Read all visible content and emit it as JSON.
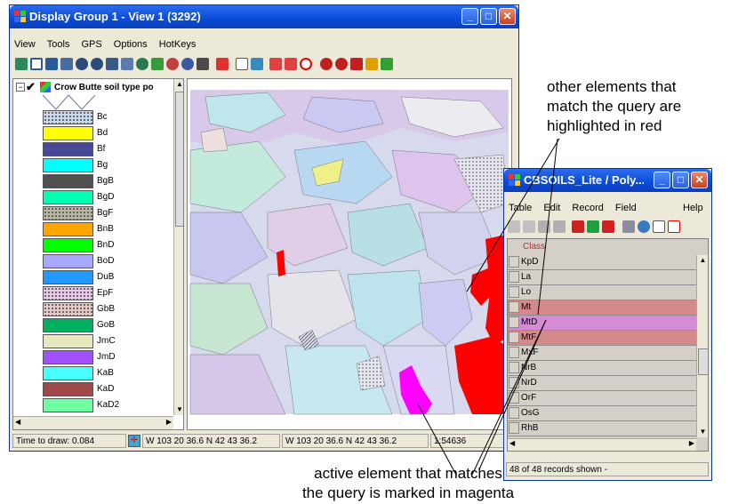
{
  "main_window": {
    "title": "Display Group 1 - View 1 (3292)",
    "menu": [
      "View",
      "Tools",
      "GPS",
      "Options",
      "HotKeys"
    ]
  },
  "layer_tree": {
    "layer_name": "Crow Butte soil type po",
    "items": [
      {
        "label": "Bc",
        "color": "#c8d8ec",
        "dots": true
      },
      {
        "label": "Bd",
        "color": "#ffff00",
        "dots": false
      },
      {
        "label": "Bf",
        "color": "#484898",
        "dots": false
      },
      {
        "label": "Bg",
        "color": "#00ffff",
        "dots": false
      },
      {
        "label": "BgB",
        "color": "#505050",
        "dots": false
      },
      {
        "label": "BgD",
        "color": "#00ffb0",
        "dots": false
      },
      {
        "label": "BgF",
        "color": "#b8b8a0",
        "dots": true
      },
      {
        "label": "BnB",
        "color": "#ffa500",
        "dots": false
      },
      {
        "label": "BnD",
        "color": "#00ff00",
        "dots": false
      },
      {
        "label": "BoD",
        "color": "#a8a8ff",
        "dots": false
      },
      {
        "label": "DuB",
        "color": "#2098ff",
        "dots": false
      },
      {
        "label": "EpF",
        "color": "#e8c8e8",
        "dots": true
      },
      {
        "label": "GbB",
        "color": "#e8c8c8",
        "dots": true
      },
      {
        "label": "GoB",
        "color": "#00b060",
        "dots": false
      },
      {
        "label": "JmC",
        "color": "#e8e8c0",
        "dots": false
      },
      {
        "label": "JmD",
        "color": "#a050ff",
        "dots": false
      },
      {
        "label": "KaB",
        "color": "#48ffff",
        "dots": false
      },
      {
        "label": "KaD",
        "color": "#a04848",
        "dots": false
      },
      {
        "label": "KaD2",
        "color": "#70ffa0",
        "dots": false
      }
    ]
  },
  "status_bar": {
    "time_label": "Time to draw: 0.084",
    "coord1": "W 103 20 36.6  N 42 43 36.2",
    "coord2": "W 103 20 36.6  N 42 43 36.2",
    "scale": "1:54636"
  },
  "table_window": {
    "title": "CBSOILS_Lite / Poly...",
    "menu": [
      "Table",
      "Edit",
      "Record",
      "Field"
    ],
    "help": "Help",
    "column_header": "Class",
    "rows": [
      {
        "value": "KpD",
        "state": "normal"
      },
      {
        "value": "La",
        "state": "normal"
      },
      {
        "value": "Lo",
        "state": "normal"
      },
      {
        "value": "Mt",
        "state": "match"
      },
      {
        "value": "MtD",
        "state": "active"
      },
      {
        "value": "MtF",
        "state": "match"
      },
      {
        "value": "MxF",
        "state": "normal"
      },
      {
        "value": "NrB",
        "state": "normal"
      },
      {
        "value": "NrD",
        "state": "normal"
      },
      {
        "value": "OrF",
        "state": "normal"
      },
      {
        "value": "OsG",
        "state": "normal"
      },
      {
        "value": "RhB",
        "state": "normal"
      }
    ],
    "status": "48 of 48 records shown -"
  },
  "colors": {
    "match": "#d48a8a",
    "active": "#d58bd5",
    "normal": "#d4d0c8"
  },
  "annotations": {
    "top": [
      "other elements that",
      "match the query are",
      "highlighted in red"
    ],
    "bottom": [
      "active element that matches",
      "the query is marked in magenta"
    ]
  }
}
